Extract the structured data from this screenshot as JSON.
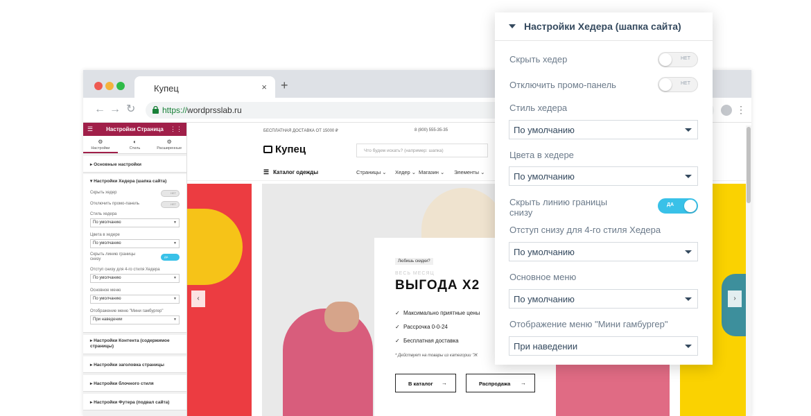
{
  "browser": {
    "tab_title": "Купец",
    "tab_close": "×",
    "new_tab": "+",
    "url_scheme": "https://",
    "url_host": "wordprsslab.ru",
    "nav_back": "←",
    "nav_forward": "→",
    "nav_reload": "↻",
    "menu_dots": "⋮"
  },
  "sidebar": {
    "title": "Настройки Страница",
    "tabs": [
      {
        "icon": "gear-icon",
        "glyph": "⚙",
        "label": "Настройки"
      },
      {
        "icon": "contrast-icon",
        "glyph": "◐",
        "label": "Стиль"
      },
      {
        "icon": "gear-icon",
        "glyph": "⚙",
        "label": "Расширенные"
      }
    ],
    "section_basic": "▸  Основные настройки",
    "section_header": "▾  Настройки Хедера (шапка сайта)",
    "hide_header": "Скрыть хедер",
    "disable_promo": "Отключить промо-панель",
    "toggle_off": "НЕТ",
    "toggle_on": "ДА",
    "header_style": "Стиль хедера",
    "header_colors": "Цвета в хедере",
    "hide_border": "Скрыть линию границы снизу",
    "bottom_padding": "Отступ снизу для 4-го стиля Хедера",
    "main_menu": "Основное меню",
    "hamburger_menu": "Отображение меню \"Мини гамбургер\"",
    "default_value": "По умолчанию",
    "on_hover": "При наведении",
    "section_content": "▸  Настройки Контента (содержимое страницы)",
    "section_title": "▸  Настройки заголовка страницы",
    "section_block": "▸  Настройки блочного стиля",
    "section_footer": "▸  Настройки Футера (подвал сайта)",
    "collapse": "‹"
  },
  "site": {
    "free_shipping": "БЕСПЛАТНАЯ ДОСТАВКА ОТ 15000 ₽",
    "phone": "8 (800) 555-35-35",
    "logo": "Купец",
    "search_placeholder": "Что будем искать? (например: шапка)",
    "catalog": "Каталог одежды",
    "menu": [
      "Страницы ⌄",
      "Хедер ⌄",
      "Магазин ⌄",
      "Элементы ⌄"
    ],
    "hero": {
      "badge": "Любишь скидки?",
      "eyebrow": "ВЕСЬ МЕСЯЦ",
      "headline": "ВЫГОДА Х2",
      "features": [
        "Максимально приятные цены",
        "Рассрочка 0-0-24",
        "Бесплатная доставка"
      ],
      "note": "* Действует на товары из категории \"Ж",
      "btn_catalog": "В каталог",
      "btn_sale": "Распродажа",
      "arrow": "→"
    },
    "slider_prev": "‹",
    "slider_next": "›"
  },
  "panel": {
    "title": "Настройки Хедера (шапка сайта)",
    "hide_header": "Скрыть хедер",
    "disable_promo": "Отключить промо-панель",
    "header_style": "Стиль хедера",
    "header_style_value": "По умолчанию",
    "header_colors": "Цвета в хедере",
    "header_colors_value": "По умолчанию",
    "hide_border": "Скрыть линию границы снизу",
    "bottom_padding": "Отступ снизу для 4-го стиля Хедера",
    "bottom_padding_value": "По умолчанию",
    "main_menu": "Основное меню",
    "main_menu_value": "По умолчанию",
    "hamburger_menu": "Отображение меню \"Мини гамбургер\"",
    "hamburger_menu_value": "При наведении",
    "toggle_off": "НЕТ",
    "toggle_on": "ДА"
  },
  "colors": {
    "sidebar_accent": "#a01f49",
    "toggle_on": "#39c1e8",
    "hero_red": "#ec3c41",
    "hero_yellow": "#fad201"
  }
}
